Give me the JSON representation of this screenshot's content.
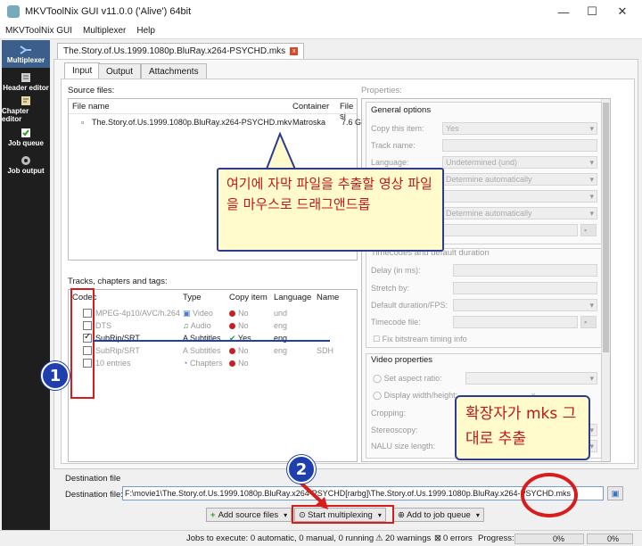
{
  "window": {
    "title": "MKVToolNix GUI v11.0.0 ('Alive') 64bit"
  },
  "menu": [
    "MKVToolNix GUI",
    "Multiplexer",
    "Help"
  ],
  "sidebar": [
    {
      "label": "Multiplexer",
      "icon": "multiplexer-icon"
    },
    {
      "label": "Header editor",
      "icon": "header-editor-icon"
    },
    {
      "label": "Chapter editor",
      "icon": "chapter-editor-icon"
    },
    {
      "label": "Job queue",
      "icon": "job-queue-icon"
    },
    {
      "label": "Job output",
      "icon": "job-output-icon"
    }
  ],
  "doc_tab": "The.Story.of.Us.1999.1080p.BluRay.x264-PSYCHD.mks",
  "tabs": [
    "Input",
    "Output",
    "Attachments"
  ],
  "source": {
    "label": "Source files:",
    "columns": [
      "File name",
      "Container",
      "File si"
    ],
    "rows": [
      {
        "name": "The.Story.of.Us.1999.1080p.BluRay.x264-PSYCHD.mkv",
        "container": "Matroska",
        "size": "7.6 G"
      }
    ]
  },
  "tracks": {
    "label": "Tracks, chapters and tags:",
    "columns": [
      "Codec",
      "Type",
      "Copy item",
      "Language",
      "Name"
    ],
    "rows": [
      {
        "checked": false,
        "codec": "MPEG-4p10/AVC/h.264",
        "type": "Video",
        "copy": "No",
        "lang": "und",
        "name": ""
      },
      {
        "checked": false,
        "codec": "DTS",
        "type": "Audio",
        "copy": "No",
        "lang": "eng",
        "name": ""
      },
      {
        "checked": true,
        "codec": "SubRip/SRT",
        "type": "Subtitles",
        "copy": "Yes",
        "lang": "eng",
        "name": ""
      },
      {
        "checked": false,
        "codec": "SubRip/SRT",
        "type": "Subtitles",
        "copy": "No",
        "lang": "eng",
        "name": "SDH"
      },
      {
        "checked": false,
        "codec": "10 entries",
        "type": "Chapters",
        "copy": "No",
        "lang": "",
        "name": ""
      }
    ]
  },
  "properties": {
    "label": "Properties:",
    "general_title": "General options",
    "general": [
      {
        "label": "Copy this item:",
        "value": "Yes"
      },
      {
        "label": "Track name:",
        "value": ""
      },
      {
        "label": "Language:",
        "value": "Undetermined (und)"
      },
      {
        "label": "",
        "value": "Determine automatically"
      },
      {
        "label": "",
        "value": ""
      },
      {
        "label": "",
        "value": "Determine automatically"
      },
      {
        "label": "",
        "value": ""
      }
    ],
    "timecodes_title": "Timecodes and default duration",
    "timecodes": [
      "Delay (in ms):",
      "Stretch by:",
      "Default duration/FPS:",
      "Timecode file:"
    ],
    "fix_bitstream": "Fix bitstream timing info",
    "video_title": "Video properties",
    "video": [
      "Set aspect ratio:",
      "Display width/height:",
      "Cropping:",
      "Stereoscopy:",
      "NALU size length:"
    ],
    "x_sep": "x"
  },
  "destination": {
    "title": "Destination file",
    "label": "Destination file:",
    "value": "F:\\movie1\\The.Story.of.Us.1999.1080p.BluRay.x264-PSYCHD[rarbg]\\The.Story.of.Us.1999.1080p.BluRay.x264-PSYCHD.mks"
  },
  "buttons": {
    "add_source": "Add source files",
    "start": "Start multiplexing",
    "add_job": "Add to job queue"
  },
  "status": {
    "jobs": "Jobs to execute: 0 automatic, 0 manual, 0 running",
    "warnings": "20 warnings",
    "errors": "0 errors",
    "progress_label": "Progress:",
    "progress1": "0%",
    "progress2": "0%"
  },
  "annotations": {
    "callout_drag": "여기에 자막 파일을 추출할 영상 파일을 마우스로 드래그앤드롭",
    "callout_ext": "확장자가 mks 그대로 추출",
    "step1": "1",
    "step2": "2"
  },
  "colors": {
    "annotation_red": "#d81b1b",
    "annotation_blue": "#1f3fae",
    "callout_bg": "#fffbcc",
    "sidebar_bg": "#1e1e1e"
  }
}
